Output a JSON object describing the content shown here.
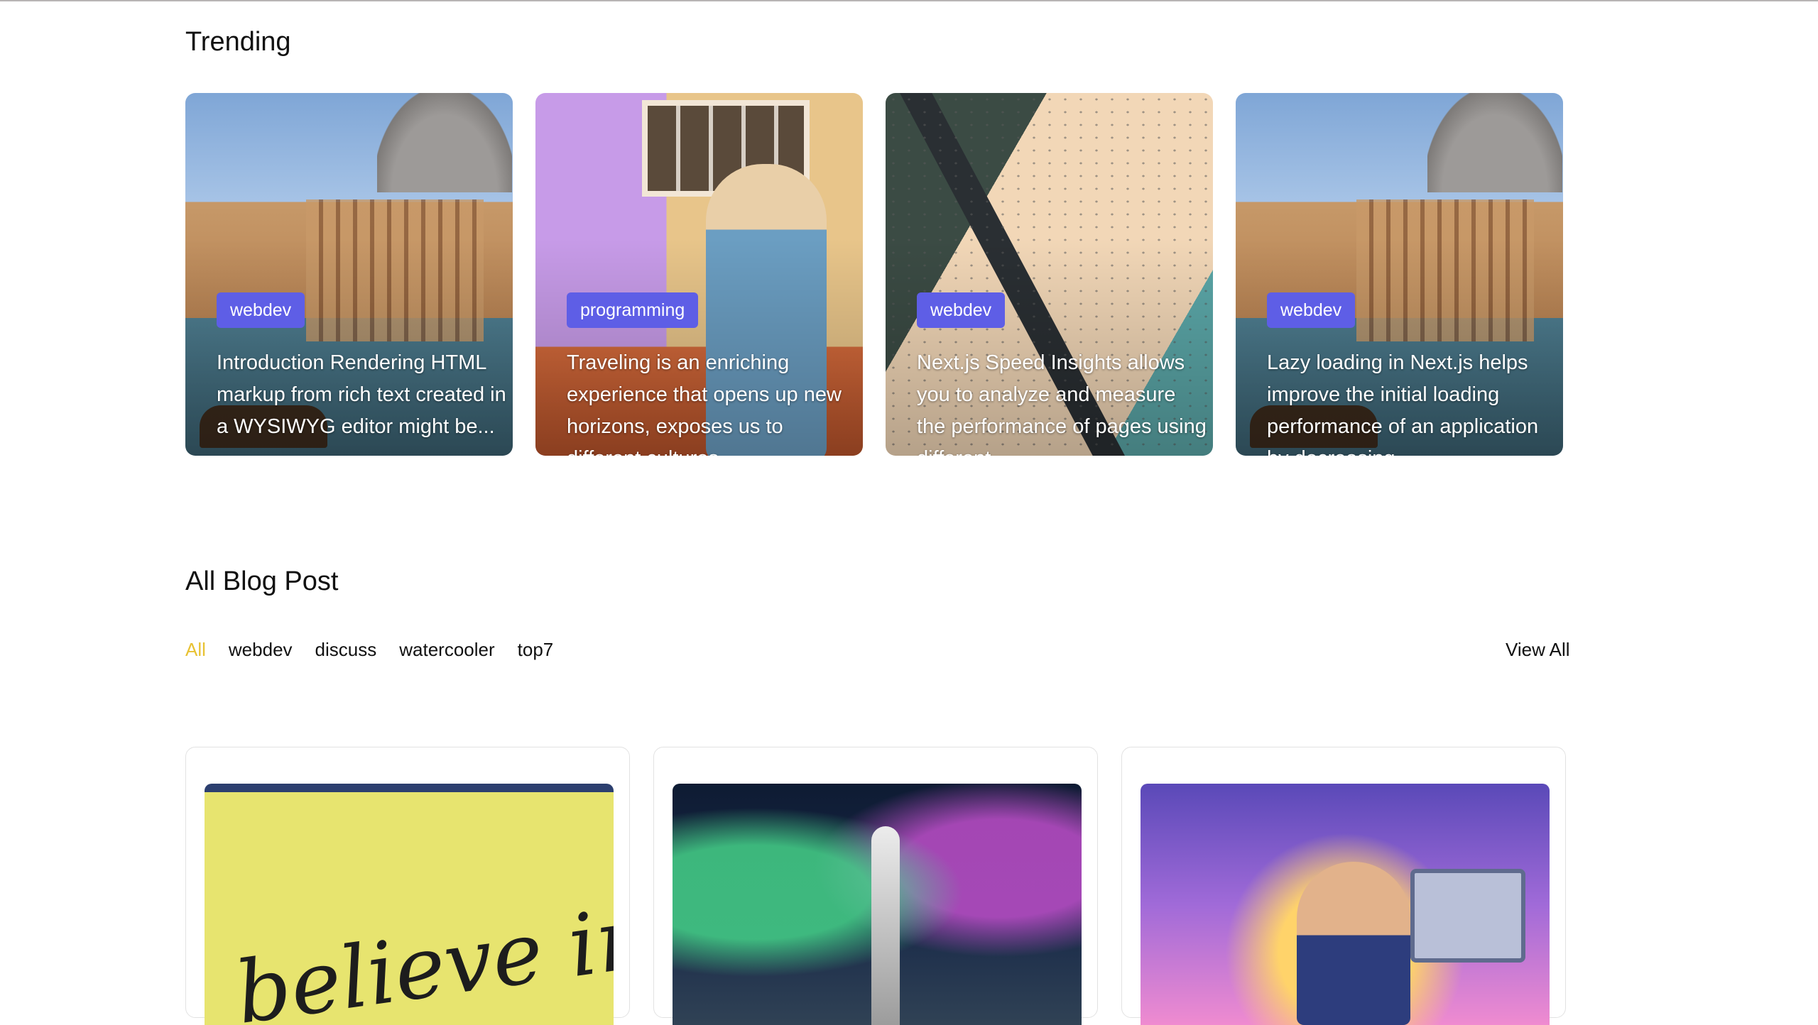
{
  "trending": {
    "title": "Trending",
    "cards": [
      {
        "tag": "webdev",
        "excerpt": "Introduction Rendering HTML markup from rich text created in a WYSIWYG editor might be..."
      },
      {
        "tag": "programming",
        "excerpt": "Traveling is an enriching experience that opens up new horizons, exposes us to different cultures..."
      },
      {
        "tag": "webdev",
        "excerpt": "Next.js Speed Insights allows you to analyze and measure the performance of pages using different..."
      },
      {
        "tag": "webdev",
        "excerpt": "Lazy loading in Next.js helps improve the initial loading performance of an application by decreasing..."
      }
    ]
  },
  "all_posts": {
    "title": "All Blog Post",
    "filters": [
      "All",
      "webdev",
      "discuss",
      "watercooler",
      "top7"
    ],
    "active_filter": "All",
    "view_all": "View All",
    "yellow_wall_text": "believe in yourself"
  },
  "colors": {
    "tag_bg": "#5e5ee6",
    "active_filter": "#e8c233"
  }
}
